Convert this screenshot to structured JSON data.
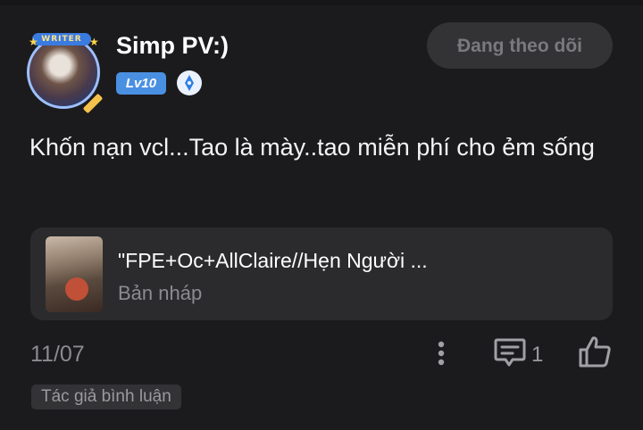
{
  "user": {
    "name": "Simp PV:)",
    "level": "Lv10",
    "avatar_frame_text": "WRITER",
    "follow_button_label": "Đang theo dõi"
  },
  "comment": {
    "text": "Khốn nạn vcl...Tao là mày..tao miễn phí cho ẻm sống",
    "date": "11/07",
    "reply_count": "1",
    "author_tag": "Tác giả bình luận"
  },
  "story_card": {
    "title": "\"FPE+Oc+AllClaire//Hẹn Người ...",
    "status": "Bản nháp"
  },
  "icons": {
    "more": "more-vertical-icon",
    "comment": "comment-icon",
    "like": "thumbs-up-icon",
    "verify": "verified-pen-icon"
  },
  "colors": {
    "background": "#1b1b1d",
    "level_badge": "#4a90e2",
    "card": "#2b2b2e",
    "muted_text": "#8b8b90"
  }
}
